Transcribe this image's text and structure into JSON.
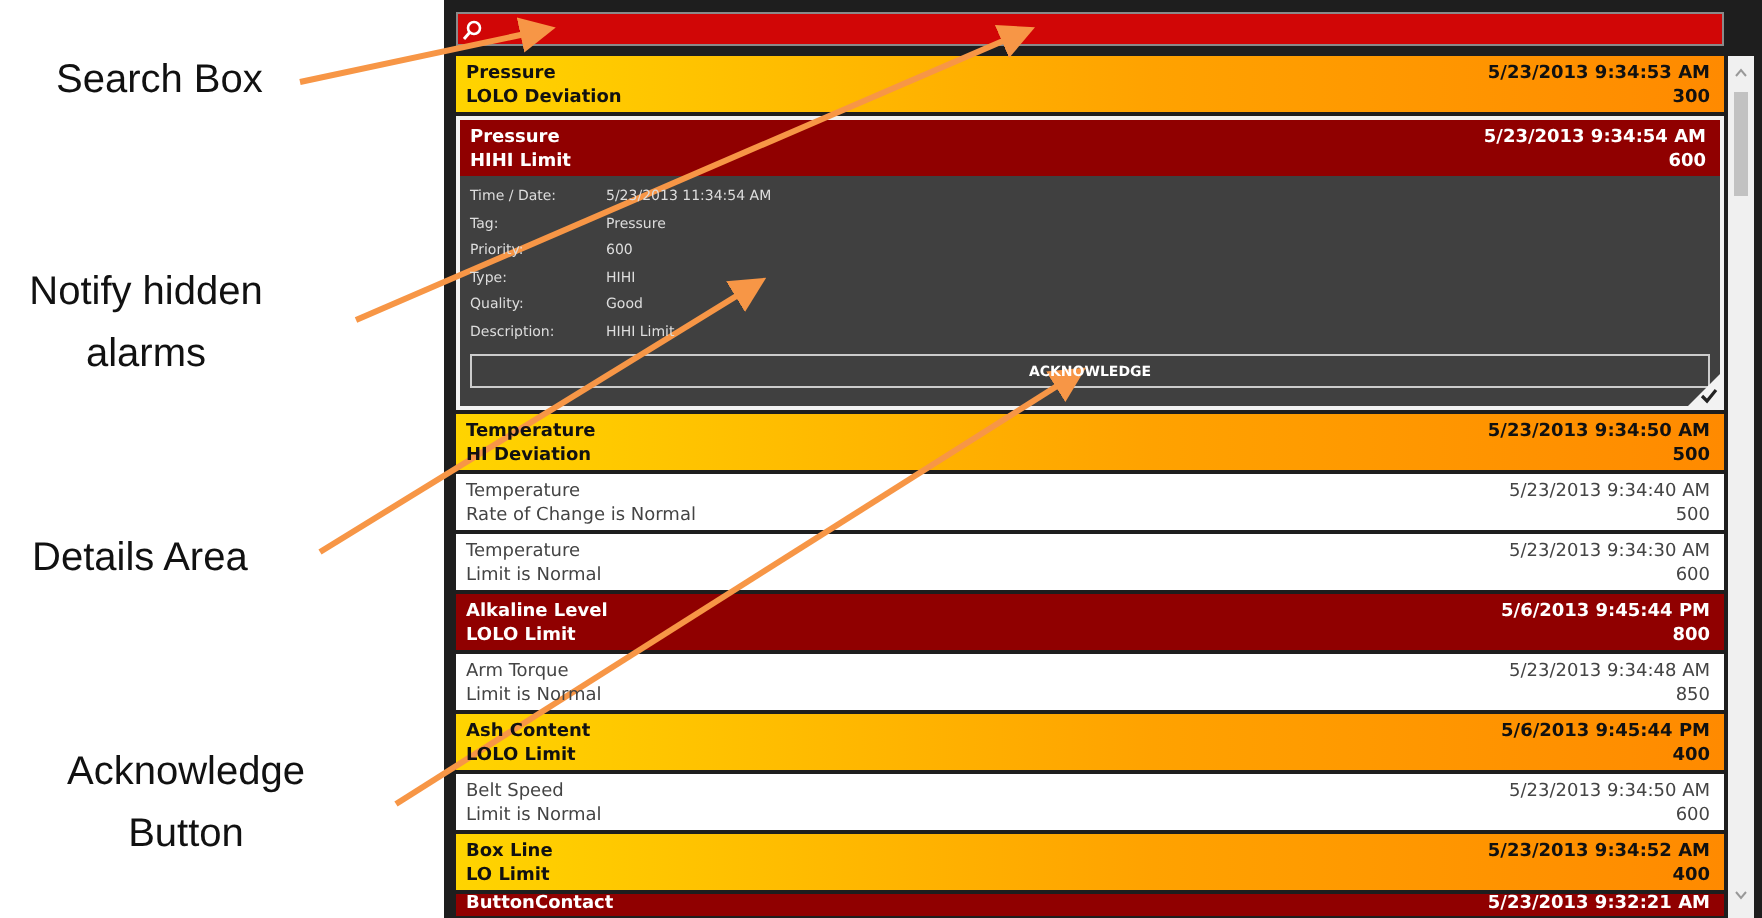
{
  "callouts": [
    {
      "label": "Search Box"
    },
    {
      "label": "Notify hidden alarms"
    },
    {
      "label": "Details Area"
    },
    {
      "label": "Acknowledge Button"
    }
  ],
  "alarms": [
    {
      "kind": "alarm",
      "tag": "Pressure",
      "description": "LOLO Deviation",
      "time": "5/23/2013 9:34:53 AM",
      "value": "300",
      "expanded": false
    },
    {
      "kind": "critical",
      "tag": "Pressure",
      "description": "HIHI Limit",
      "time": "5/23/2013 9:34:54 AM",
      "value": "600",
      "expanded": true,
      "details": [
        {
          "label": "Time / Date:",
          "value": "5/23/2013 11:34:54 AM"
        },
        {
          "label": "Tag:",
          "value": "Pressure"
        },
        {
          "label": "Priority:",
          "value": "600"
        },
        {
          "label": "Type:",
          "value": "HIHI"
        },
        {
          "label": "Quality:",
          "value": "Good"
        },
        {
          "label": "Description:",
          "value": "HIHI Limit"
        }
      ],
      "action": "ACKNOWLEDGE"
    },
    {
      "kind": "alarm",
      "tag": "Temperature",
      "description": "HI Deviation",
      "time": "5/23/2013 9:34:50 AM",
      "value": "500",
      "expanded": false
    },
    {
      "kind": "normal",
      "tag": "Temperature",
      "description": "Rate of Change is Normal",
      "time": "5/23/2013 9:34:40 AM",
      "value": "500",
      "expanded": false
    },
    {
      "kind": "normal",
      "tag": "Temperature",
      "description": "Limit is Normal",
      "time": "5/23/2013 9:34:30 AM",
      "value": "600",
      "expanded": false
    },
    {
      "kind": "critical",
      "tag": "Alkaline Level",
      "description": "LOLO Limit",
      "time": "5/6/2013 9:45:44 PM",
      "value": "800",
      "expanded": false
    },
    {
      "kind": "normal",
      "tag": "Arm Torque",
      "description": "Limit is Normal",
      "time": "5/23/2013 9:34:48 AM",
      "value": "850",
      "expanded": false
    },
    {
      "kind": "alarm",
      "tag": "Ash Content",
      "description": "LOLO Limit",
      "time": "5/6/2013 9:45:44 PM",
      "value": "400",
      "expanded": false
    },
    {
      "kind": "normal",
      "tag": "Belt Speed",
      "description": "Limit is Normal",
      "time": "5/23/2013 9:34:50 AM",
      "value": "600",
      "expanded": false
    },
    {
      "kind": "alarm",
      "tag": "Box Line",
      "description": "LO Limit",
      "time": "5/23/2013 9:34:52 AM",
      "value": "400",
      "expanded": false
    },
    {
      "kind": "critical",
      "tag": "ButtonContact",
      "time": "5/23/2013 9:32:21 AM",
      "expanded": false
    }
  ]
}
